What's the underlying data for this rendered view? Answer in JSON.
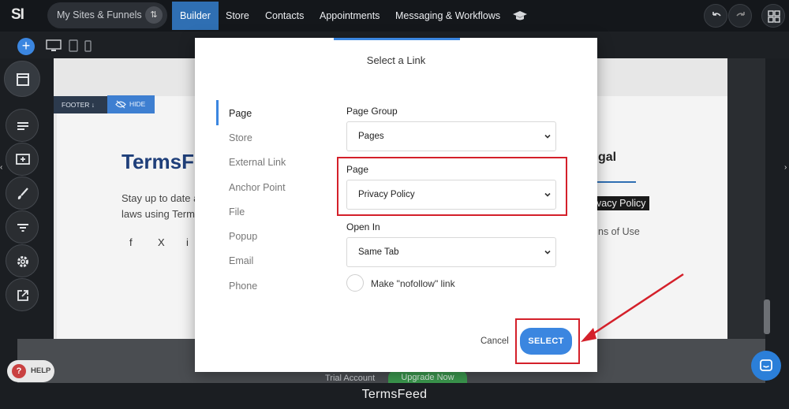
{
  "topbar": {
    "logo": "SI",
    "sites_label": "My Sites & Funnels",
    "tabs": [
      {
        "label": "Builder",
        "active": true
      },
      {
        "label": "Store",
        "active": false
      },
      {
        "label": "Contacts",
        "active": false
      },
      {
        "label": "Appointments",
        "active": false
      },
      {
        "label": "Messaging & Workflows",
        "active": false
      }
    ],
    "accent_color": "#2f6fb3"
  },
  "canvas": {
    "footer_tag": "FOOTER ↓",
    "hide_tag": "HIDE",
    "brand_text": "TermsF",
    "body_line_1": "Stay up to date a",
    "body_line_2": "laws using Term",
    "socials": [
      "f",
      "X",
      "i"
    ],
    "legal_heading": "gal",
    "highlighted_link": "vacy Policy",
    "terms_link": "ns of Use"
  },
  "bottom": {
    "help_label": "HELP",
    "trial_text": "Trial Account",
    "upgrade_label": "Upgrade Now"
  },
  "modal": {
    "title": "Select a Link",
    "link_types": [
      {
        "label": "Page",
        "active": true
      },
      {
        "label": "Store",
        "active": false
      },
      {
        "label": "External Link",
        "active": false
      },
      {
        "label": "Anchor Point",
        "active": false
      },
      {
        "label": "File",
        "active": false
      },
      {
        "label": "Popup",
        "active": false
      },
      {
        "label": "Email",
        "active": false
      },
      {
        "label": "Phone",
        "active": false
      }
    ],
    "page_group": {
      "label": "Page Group",
      "value": "Pages"
    },
    "page": {
      "label": "Page",
      "value": "Privacy Policy"
    },
    "open_in": {
      "label": "Open In",
      "value": "Same Tab"
    },
    "nofollow_label": "Make \"nofollow\" link",
    "nofollow_checked": false,
    "cancel_label": "Cancel",
    "select_label": "SELECT",
    "button_color": "#3b86e0",
    "highlight_color": "#d4202a"
  },
  "caption": "TermsFeed"
}
